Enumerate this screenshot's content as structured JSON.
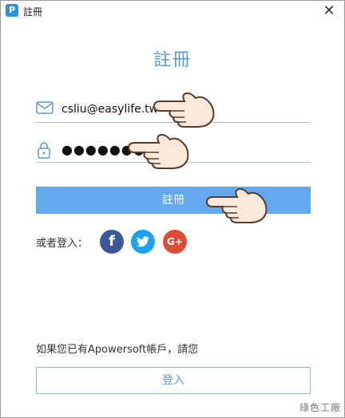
{
  "window": {
    "title": "註冊",
    "app_icon_letter": "P",
    "close_glyph": "✕"
  },
  "form": {
    "heading": "註冊",
    "email_value": "csliu@easylife.tw",
    "password_value": "●●●●●●●●",
    "register_label": "註冊"
  },
  "social": {
    "label": "或者登入：",
    "facebook_glyph": "f",
    "twitter_glyph": "🐦",
    "googleplus_glyph": "G+"
  },
  "footer": {
    "prompt": "如果您已有Apowersoft帳戶，請您",
    "login_label": "登入"
  },
  "watermark": "綠色工廠",
  "colors": {
    "accent": "#62a8ec",
    "heading": "#5a9ad6",
    "facebook": "#3b5998",
    "twitter": "#1da1f2",
    "googleplus": "#dd4b39"
  },
  "icons": [
    "app-icon",
    "close-icon",
    "email-icon",
    "lock-icon",
    "facebook-icon",
    "twitter-icon",
    "googleplus-icon",
    "pointing-hand-icon"
  ]
}
